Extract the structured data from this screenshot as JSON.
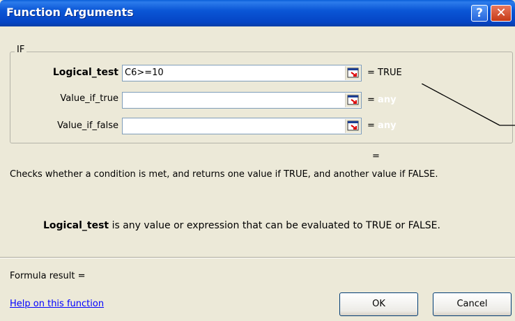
{
  "window": {
    "title": "Function Arguments",
    "help_icon": "help-icon",
    "close_icon": "close-icon"
  },
  "group": {
    "label": "IF",
    "arguments": [
      {
        "label": "Logical_test",
        "value": "C6>=10",
        "result": "= TRUE"
      },
      {
        "label": "Value_if_true",
        "value": "",
        "result": "=",
        "result_hint": "any"
      },
      {
        "label": "Value_if_false",
        "value": "",
        "result": "=",
        "result_hint": "any"
      }
    ]
  },
  "overall_result": "=",
  "description": "Checks whether a condition is met, and returns one value if TRUE, and another value if FALSE.",
  "argument_help": {
    "name": "Logical_test",
    "text": " is any value or expression that can be evaluated to TRUE or FALSE."
  },
  "formula_result_label": "Formula result =",
  "help_link": "Help on this function",
  "buttons": {
    "ok": "OK",
    "cancel": "Cancel"
  },
  "icons": [
    "help-icon",
    "close-icon",
    "collapse-dialog-icon"
  ],
  "colors": {
    "titlebar": "#0A56D6",
    "dialog_bg": "#ECE9D8",
    "link": "#0000FF"
  }
}
